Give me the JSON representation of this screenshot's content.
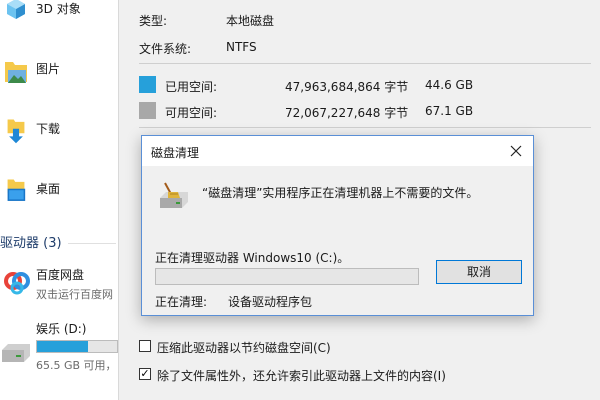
{
  "explorer": {
    "items": [
      {
        "label": "3D 对象"
      },
      {
        "label": "图片"
      },
      {
        "label": "下载"
      },
      {
        "label": "桌面"
      }
    ],
    "section_label": "驱动器 (3)",
    "drives": [
      {
        "name": "百度网盘",
        "subtitle": "双击运行百度网"
      },
      {
        "name": "娱乐 (D:)",
        "free_text": "65.5 GB 可用，",
        "used_fraction": 0.64
      }
    ]
  },
  "properties": {
    "type_label": "类型:",
    "type_value": "本地磁盘",
    "fs_label": "文件系统:",
    "fs_value": "NTFS",
    "used_label": "已用空间:",
    "used_bytes": "47,963,684,864 字节",
    "used_gb": "44.6 GB",
    "free_label": "可用空间:",
    "free_bytes": "72,067,227,648 字节",
    "free_gb": "67.1 GB",
    "compress_label": "压缩此驱动器以节约磁盘空间(C)",
    "compress_checked": false,
    "index_label": "除了文件属性外，还允许索引此驱动器上文件的内容(I)",
    "index_checked": true,
    "used_color": "#26a0da",
    "free_color": "#a8a8a8"
  },
  "dialog": {
    "title": "磁盘清理",
    "message": "“磁盘清理”实用程序正在清理机器上不需要的文件。",
    "cleaning_text": "正在清理驱动器 Windows10 (C:)。",
    "progress_fraction": 0,
    "cancel_label": "取消",
    "status_label": "正在清理:",
    "status_value": "设备驱动程序包"
  }
}
